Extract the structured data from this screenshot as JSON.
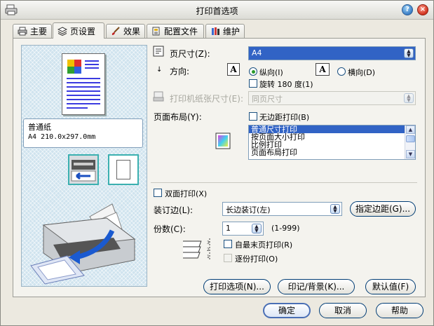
{
  "window": {
    "title": "打印首选项",
    "help_symbol": "?",
    "close_symbol": "×"
  },
  "tabs": [
    {
      "label": "主要",
      "icon": "printer-icon"
    },
    {
      "label": "页设置",
      "icon": "page-layers-icon",
      "active": true
    },
    {
      "label": "效果",
      "icon": "brush-icon"
    },
    {
      "label": "配置文件",
      "icon": "profile-icon"
    },
    {
      "label": "维护",
      "icon": "tools-icon"
    }
  ],
  "preview": {
    "paper_type": "普通纸",
    "paper_size": "A4 210.0x297.0mm"
  },
  "page_size": {
    "label": "页尺寸(Z):",
    "value": "A4"
  },
  "orientation": {
    "label": "方向:",
    "portrait_glyph": "A",
    "portrait_label": "纵向(I)",
    "landscape_glyph": "A",
    "landscape_label": "横向(D)",
    "selected": "portrait",
    "rotate_label": "旋转 180 度(1)"
  },
  "printer_paper_size": {
    "label": "打印机纸张尺寸(E):",
    "value": "同页尺寸"
  },
  "page_layout": {
    "label": "页面布局(Y):",
    "borderless_label": "无边距打印(B)",
    "options": [
      "普通尺寸打印",
      "按页面大小打印",
      "比例打印",
      "页面布局打印"
    ],
    "selected_index": 0
  },
  "duplex": {
    "label": "双面打印(X)"
  },
  "binding": {
    "label": "装订边(L):",
    "value": "长边装订(左)",
    "margin_button": "指定边距(G)..."
  },
  "copies": {
    "label": "份数(C):",
    "value": "1",
    "range": "(1-999)",
    "reverse_label": "自最末页打印(R)",
    "collate_label": "逐份打印(O)"
  },
  "panel_buttons": {
    "print_options": "打印选项(N)...",
    "stamp_background": "印记/背景(K)...",
    "defaults": "默认值(F)"
  },
  "footer_buttons": {
    "ok": "确定",
    "cancel": "取消",
    "help": "帮助"
  },
  "colors": {
    "selection": "#3163c5",
    "preview_bg": "#cfe3ee",
    "accent_teal": "#3bb0b0"
  }
}
